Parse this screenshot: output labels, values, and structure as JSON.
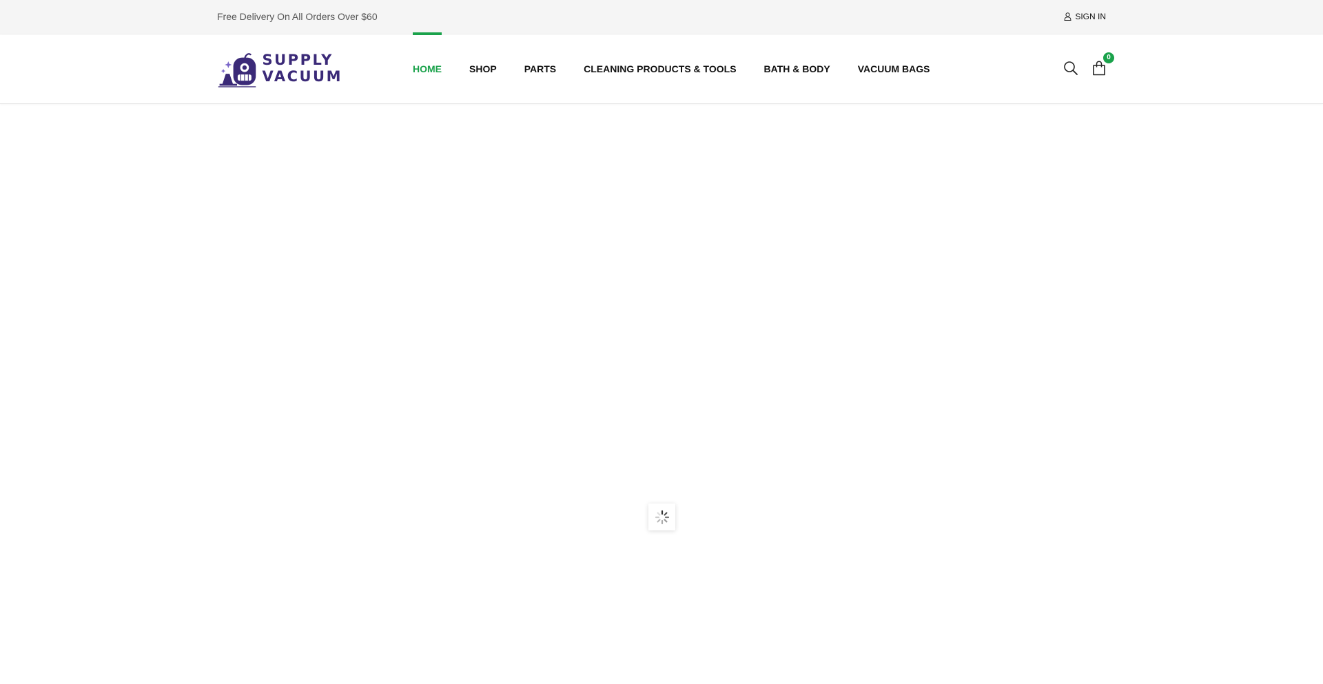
{
  "topbar": {
    "promo_text": "Free Delivery On All Orders Over $60",
    "signin_label": "SIGN IN",
    "signin_icon": "user-icon"
  },
  "header": {
    "logo": {
      "line1": "SUPPLY",
      "line2": "VACUUM",
      "brand_color": "#3b2a78"
    },
    "nav": [
      {
        "label": "HOME",
        "active": true
      },
      {
        "label": "SHOP",
        "active": false
      },
      {
        "label": "PARTS",
        "active": false
      },
      {
        "label": "CLEANING PRODUCTS & TOOLS",
        "active": false
      },
      {
        "label": "BATH & BODY",
        "active": false
      },
      {
        "label": "VACUUM BAGS",
        "active": false
      }
    ],
    "search_icon": "search-icon",
    "cart_icon": "shopping-bag-icon",
    "cart_count": "0"
  },
  "loader": {
    "icon": "spinner-icon"
  },
  "colors": {
    "accent": "#1aa24b",
    "topbar_bg": "#f5f5f5",
    "text": "#111111"
  }
}
